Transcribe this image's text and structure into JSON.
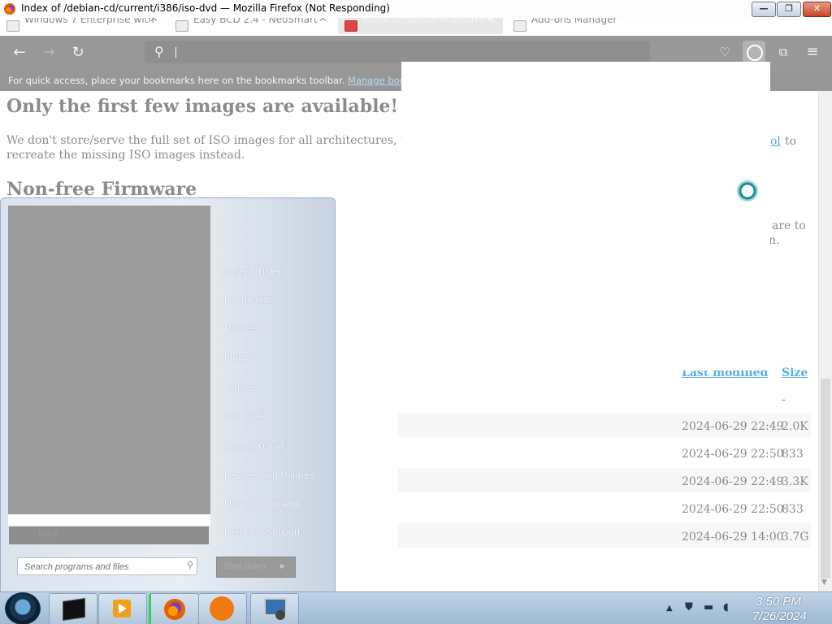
{
  "window": {
    "title": "Index of /debian-cd/current/i386/iso-dvd — Mozilla Firefox (Not Responding)",
    "minimize_glyph": "—",
    "maximize_glyph": "❐",
    "close_glyph": "✕"
  },
  "tabs": [
    {
      "label": "Windows 7 Enterprise with",
      "close": "✕"
    },
    {
      "label": "Easy BCD 2.4 - NeoSmart",
      "close": "✕"
    },
    {
      "label": "Index of /debian-cd/curre",
      "close": "✕"
    },
    {
      "label": "Add-ons Manager",
      "close": ""
    }
  ],
  "toolbar": {
    "back_glyph": "←",
    "forward_glyph": "→",
    "reload_glyph": "↻",
    "search_glyph": "⚲",
    "pocket_glyph": "♡",
    "extensions_glyph": "⧉",
    "menu_glyph": "≡"
  },
  "bookmarks": {
    "text": "For quick access, place your bookmarks here on the bookmarks toolbar.",
    "link": "Manage bookmarks"
  },
  "page": {
    "heading_images": "Only the first few images are available! Where a",
    "para_images_1": "We don't store/serve the full set of ISO images for all architectures, to reduc",
    "para_images_2": "recreate the missing ISO images instead.",
    "para_images_tail_link": "ol",
    "para_images_tail": "to",
    "heading_firmware": "Non-free Firmware",
    "firmware_tail_1": "are to",
    "firmware_tail_2": "n.",
    "col_last_modified": "Last modified",
    "col_size": "Size",
    "rows": [
      {
        "date": "",
        "size": "-"
      },
      {
        "date": "2024-06-29 22:49",
        "size": "2.0K"
      },
      {
        "date": "2024-06-29 22:50",
        "size": "833"
      },
      {
        "date": "2024-06-29 22:49",
        "size": "3.3K"
      },
      {
        "date": "2024-06-29 22:50",
        "size": "833"
      },
      {
        "date": "2024-06-29 14:00",
        "size": "3.7G"
      }
    ]
  },
  "start_menu": {
    "items": [
      "Joseph Biden",
      "Documents",
      "Pictures",
      "Music",
      "Games",
      "Computer",
      "Control Panel",
      "Devices and Printers",
      "Default Programs",
      "Help and Support"
    ],
    "back_label": "Back",
    "search_placeholder": "Search programs and files",
    "shutdown_label": "Shut down",
    "shutdown_arrow": "▸"
  },
  "taskbar": {
    "apps": [
      "cmd-icon",
      "media-player-icon",
      "firefox-icon",
      "avast-icon",
      "network-tool-icon"
    ],
    "time": "3:50 PM",
    "date": "7/26/2024"
  }
}
